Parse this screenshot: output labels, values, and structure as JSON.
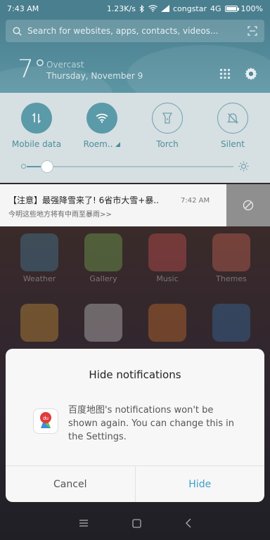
{
  "status_bar": {
    "time": "7:43 AM",
    "speed": "1.23K/s",
    "carrier": "congstar",
    "network": "4G",
    "battery": "100%"
  },
  "search": {
    "placeholder": "Search for websites, apps, contacts, videos..."
  },
  "weather": {
    "temperature": "7°",
    "condition": "Overcast",
    "date": "Thursday, November 9"
  },
  "quick_settings": {
    "toggles": [
      {
        "label": "Mobile data",
        "icon": "mobile-data-icon",
        "on": true
      },
      {
        "label": "Roem..",
        "icon": "wifi-icon",
        "on": true
      },
      {
        "label": "Torch",
        "icon": "torch-icon",
        "on": false
      },
      {
        "label": "Silent",
        "icon": "silent-icon",
        "on": false
      }
    ],
    "brightness_level": 0.1
  },
  "notification": {
    "title": "【注意】最强降雪来了! 6省市大雪+暴..",
    "time": "7:42 AM",
    "body": "今明这些地方将有中雨至暴雨>>"
  },
  "home_apps": [
    {
      "label": "Weather"
    },
    {
      "label": "Gallery"
    },
    {
      "label": "Music"
    },
    {
      "label": "Themes"
    }
  ],
  "dialog": {
    "title": "Hide  notifications",
    "message": "百度地图's notifications won't be shown again. You can change this in the Settings.",
    "app_badge_text": "du",
    "cancel_label": "Cancel",
    "hide_label": "Hide"
  },
  "colors": {
    "accent": "#3aa0c9",
    "header": "#4a7f8f",
    "quick_settings_bg": "#d6dfe2"
  }
}
